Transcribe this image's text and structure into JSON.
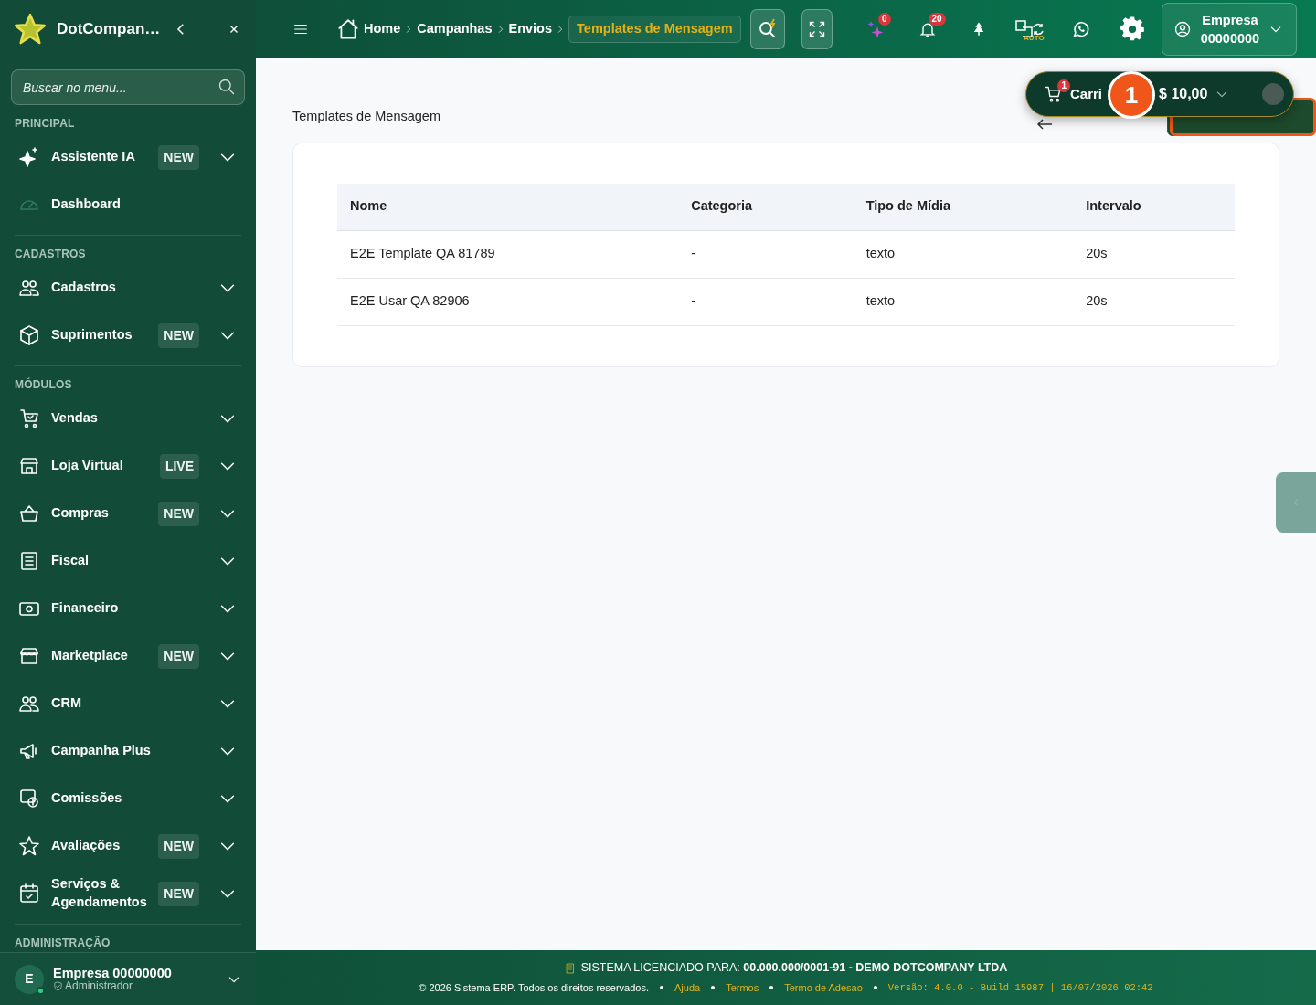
{
  "sidebar": {
    "brand": "DotCompan…",
    "search": {
      "placeholder": "Buscar no menu..."
    },
    "sections": [
      {
        "title": "PRINCIPAL",
        "items": [
          {
            "label": "Assistente IA",
            "badge": "NEW",
            "expandable": true,
            "dimmed_icon": false
          },
          {
            "label": "Dashboard",
            "expandable": false,
            "dimmed_icon": true
          }
        ]
      },
      {
        "title": "CADASTROS",
        "items": [
          {
            "label": "Cadastros",
            "expandable": true,
            "dimmed_icon": false
          },
          {
            "label": "Suprimentos",
            "badge": "NEW",
            "expandable": true,
            "dimmed_icon": false
          }
        ]
      },
      {
        "title": "MÓDULOS",
        "items": [
          {
            "label": "Vendas",
            "expandable": true,
            "dimmed_icon": false
          },
          {
            "label": "Loja Virtual",
            "badge": "LIVE",
            "expandable": true,
            "dimmed_icon": false
          },
          {
            "label": "Compras",
            "badge": "NEW",
            "expandable": true,
            "dimmed_icon": false
          },
          {
            "label": "Fiscal",
            "expandable": true,
            "dimmed_icon": false
          },
          {
            "label": "Financeiro",
            "expandable": true,
            "dimmed_icon": false
          },
          {
            "label": "Marketplace",
            "badge": "NEW",
            "expandable": true,
            "dimmed_icon": false
          },
          {
            "label": "CRM",
            "expandable": true,
            "dimmed_icon": false
          },
          {
            "label": "Campanha Plus",
            "expandable": true,
            "dimmed_icon": false
          },
          {
            "label": "Comissões",
            "expandable": true,
            "dimmed_icon": false
          },
          {
            "label": "Avaliações",
            "badge": "NEW",
            "expandable": true,
            "dimmed_icon": false
          },
          {
            "label": "Serviços & Agendamentos",
            "badge": "NEW",
            "expandable": true,
            "dimmed_icon": false
          }
        ]
      },
      {
        "title": "ADMINISTRAÇÃO"
      }
    ],
    "user": {
      "initial": "E",
      "online": true,
      "name": "Empresa 00000000",
      "role": "Administrador"
    }
  },
  "topbar": {
    "breadcrumb": [
      {
        "label": "Home",
        "selected": false
      },
      {
        "label": "Campanhas",
        "selected": false
      },
      {
        "label": "Envios",
        "selected": false
      },
      {
        "label": "Templates de Mensagem",
        "selected": true
      }
    ],
    "ai_badge": "0",
    "notifications_badge": "20",
    "translate_label": "AUTO",
    "company": {
      "line1": "Empresa",
      "line2": "00000000"
    }
  },
  "cart": {
    "badge": "1",
    "label": "Carri",
    "total": "$ 10,00"
  },
  "tour": {
    "step": "1"
  },
  "page": {
    "title": "Templates de Mensagem"
  },
  "table": {
    "columns": [
      "Nome",
      "Categoria",
      "Tipo de Mídia",
      "Intervalo"
    ],
    "rows": [
      [
        "E2E Template QA 81789",
        "-",
        "texto",
        "20s"
      ],
      [
        "E2E Usar QA 82906",
        "-",
        "texto",
        "20s"
      ]
    ]
  },
  "footer": {
    "license": "SISTEMA LICENCIADO PARA: **00.000.000/0001-91 - DEMO DOTCOMPANY LTDA**",
    "copyright": "© 2026 Sistema ERP. Todos os direitos reservados.",
    "links": [
      "Ajuda",
      "Termos",
      "Termo de Adesao"
    ],
    "version": "Versão: 4.0.0 - Build 15987 | 16/07/2026 02:42"
  }
}
